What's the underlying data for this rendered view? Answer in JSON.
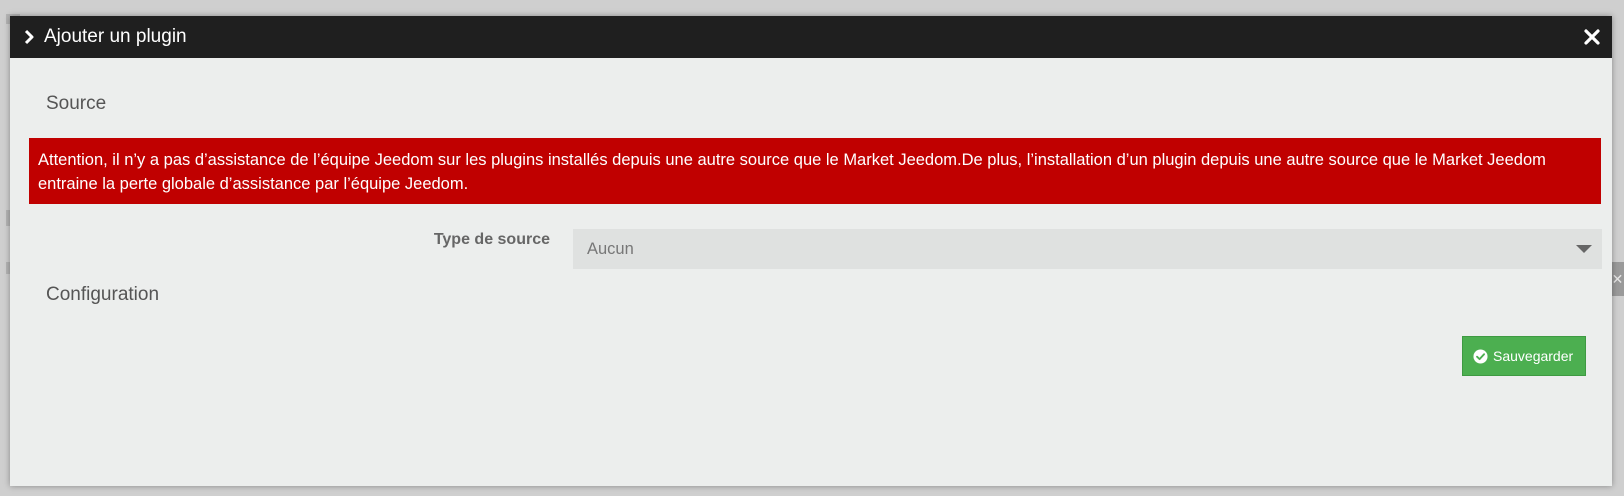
{
  "modal": {
    "title": "Ajouter un plugin",
    "icons": {
      "title": "chevron-right-icon",
      "close": "close-icon"
    }
  },
  "source_section": {
    "title": "Source",
    "alert": {
      "text": "Attention, il n’y a pas d’assistance de l’équipe Jeedom sur les plugins installés depuis une autre source que le Market Jeedom.De plus, l’installation d’un plugin depuis une autre source que le Market Jeedom entraine la perte globale d’assistance par l’équipe Jeedom.",
      "color": "#c00000"
    },
    "source_type": {
      "label": "Type de source",
      "selected": "Aucun",
      "icon": "chevron-down-icon"
    }
  },
  "configuration_section": {
    "title": "Configuration"
  },
  "actions": {
    "save_label": "Sauvegarder",
    "save_icon": "check-circle-icon",
    "save_color": "#4caf50"
  },
  "colors": {
    "titlebar": "#1f1f1f",
    "modal_bg": "#eceeed"
  }
}
